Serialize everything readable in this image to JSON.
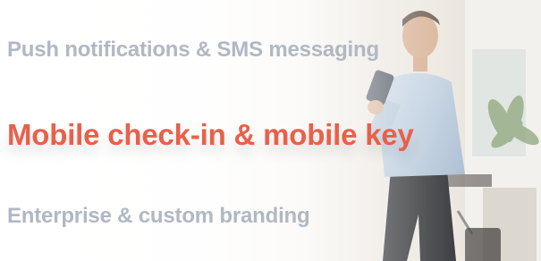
{
  "features": {
    "items": [
      {
        "label": "Push notifications & SMS messaging",
        "active": false
      },
      {
        "label": "Mobile check-in & mobile key",
        "active": true
      },
      {
        "label": "Enterprise & custom branding",
        "active": false
      }
    ]
  },
  "colors": {
    "active": "#e9604a",
    "inactive": "#b0b8c3"
  },
  "photo": {
    "subject": "businessman-with-phone-and-luggage"
  }
}
